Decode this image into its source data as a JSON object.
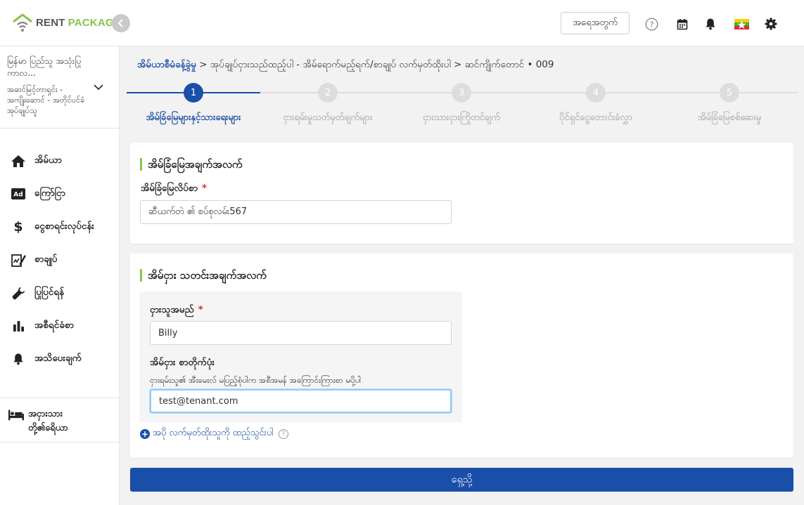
{
  "brand": {
    "rent": "RENT",
    "package": "PACKAGE",
    "accent": "#8bc34a",
    "primary": "#1a4fa8"
  },
  "topbar": {
    "feedback_label": "အရေအတွက်"
  },
  "sidebar": {
    "org_name": "မြန်မာ ပြည်သူ အသုံးပြု ကာလ...",
    "org_role": "အဆင်မြင့်တာရှင်း - အကျိုးဆောင် - အတိုင်ပင်ခံအုပ်ချုပ်သူ",
    "items": [
      {
        "label": "အိမ်ယာ",
        "icon": "home-icon"
      },
      {
        "label": "ကြော်ငြာ",
        "icon": "ad-icon"
      },
      {
        "label": "ငွေစာရင်းလုပ်ငန်း",
        "icon": "dollar-icon"
      },
      {
        "label": "စာချုပ်",
        "icon": "contract-icon"
      },
      {
        "label": "ပြုပြင်ရန်",
        "icon": "wrench-icon"
      },
      {
        "label": "အစီရင်ခံစာ",
        "icon": "bar-chart-icon"
      },
      {
        "label": "အသိပေးချက်",
        "icon": "bell-icon"
      }
    ],
    "tenant_label": "အငှားသား တို့၏ရေိယာ"
  },
  "breadcrumb": {
    "root": "အိမ်ယာစီမံခန့်ခွဲမှု",
    "rest": " > အုပ်ချုပ်ငှားသည်ထည့်ပါ - အိမ်ရောက်မည့်ရက်/စာချုပ် လက်မှတ်ထိုးပါ > ဆင်ကျိုက်တောင် • 009"
  },
  "stepper": {
    "steps": [
      {
        "number": "1",
        "label": "အိမ်ခြံမြေများနှင့်သားရေးများ",
        "active": true
      },
      {
        "number": "2",
        "label": "ငှားရမ်းမှုသတ်မှတ်ချက်များ",
        "active": false
      },
      {
        "number": "3",
        "label": "ငှားသားငှားကြိုတင်ချက်",
        "active": false
      },
      {
        "number": "4",
        "label": "ပိုင်ရှင်ငွေတောင်းခံလွှာ",
        "active": false
      },
      {
        "number": "5",
        "label": "အိမ်ခြံမြေစစ်ဆေးမှု",
        "active": false
      }
    ]
  },
  "property_section": {
    "title": "အိမ်ခြံမြေအချက်အလက်",
    "address_label": "အိမ်ခြံမြေလိပ်စာ",
    "address_value": "ဆီယက်တဲ ၏ စပ်စုလမ်း567"
  },
  "tenant_section": {
    "title": "အိမ်ငှား သတင်းအချက်အလက်",
    "name_label": "ငှားသူအမည်",
    "name_value": "Billy",
    "email_label": "အိမ်ငှား စာတိုက်ပုံး",
    "email_hint": "ငှားရမ်းသူ၏ အီးမေးလ် မပြည့်စုံပါက အစီအမန် အကြောင်းကြားစာ မပို့ပါ",
    "email_value": "test@tenant.com",
    "add_tenant_label": "အပို လက်မှတ်ထိုးသူကို ထည့်သွင်းပါ"
  },
  "required_mark": "*",
  "next_button": "ရှေ့သို့"
}
